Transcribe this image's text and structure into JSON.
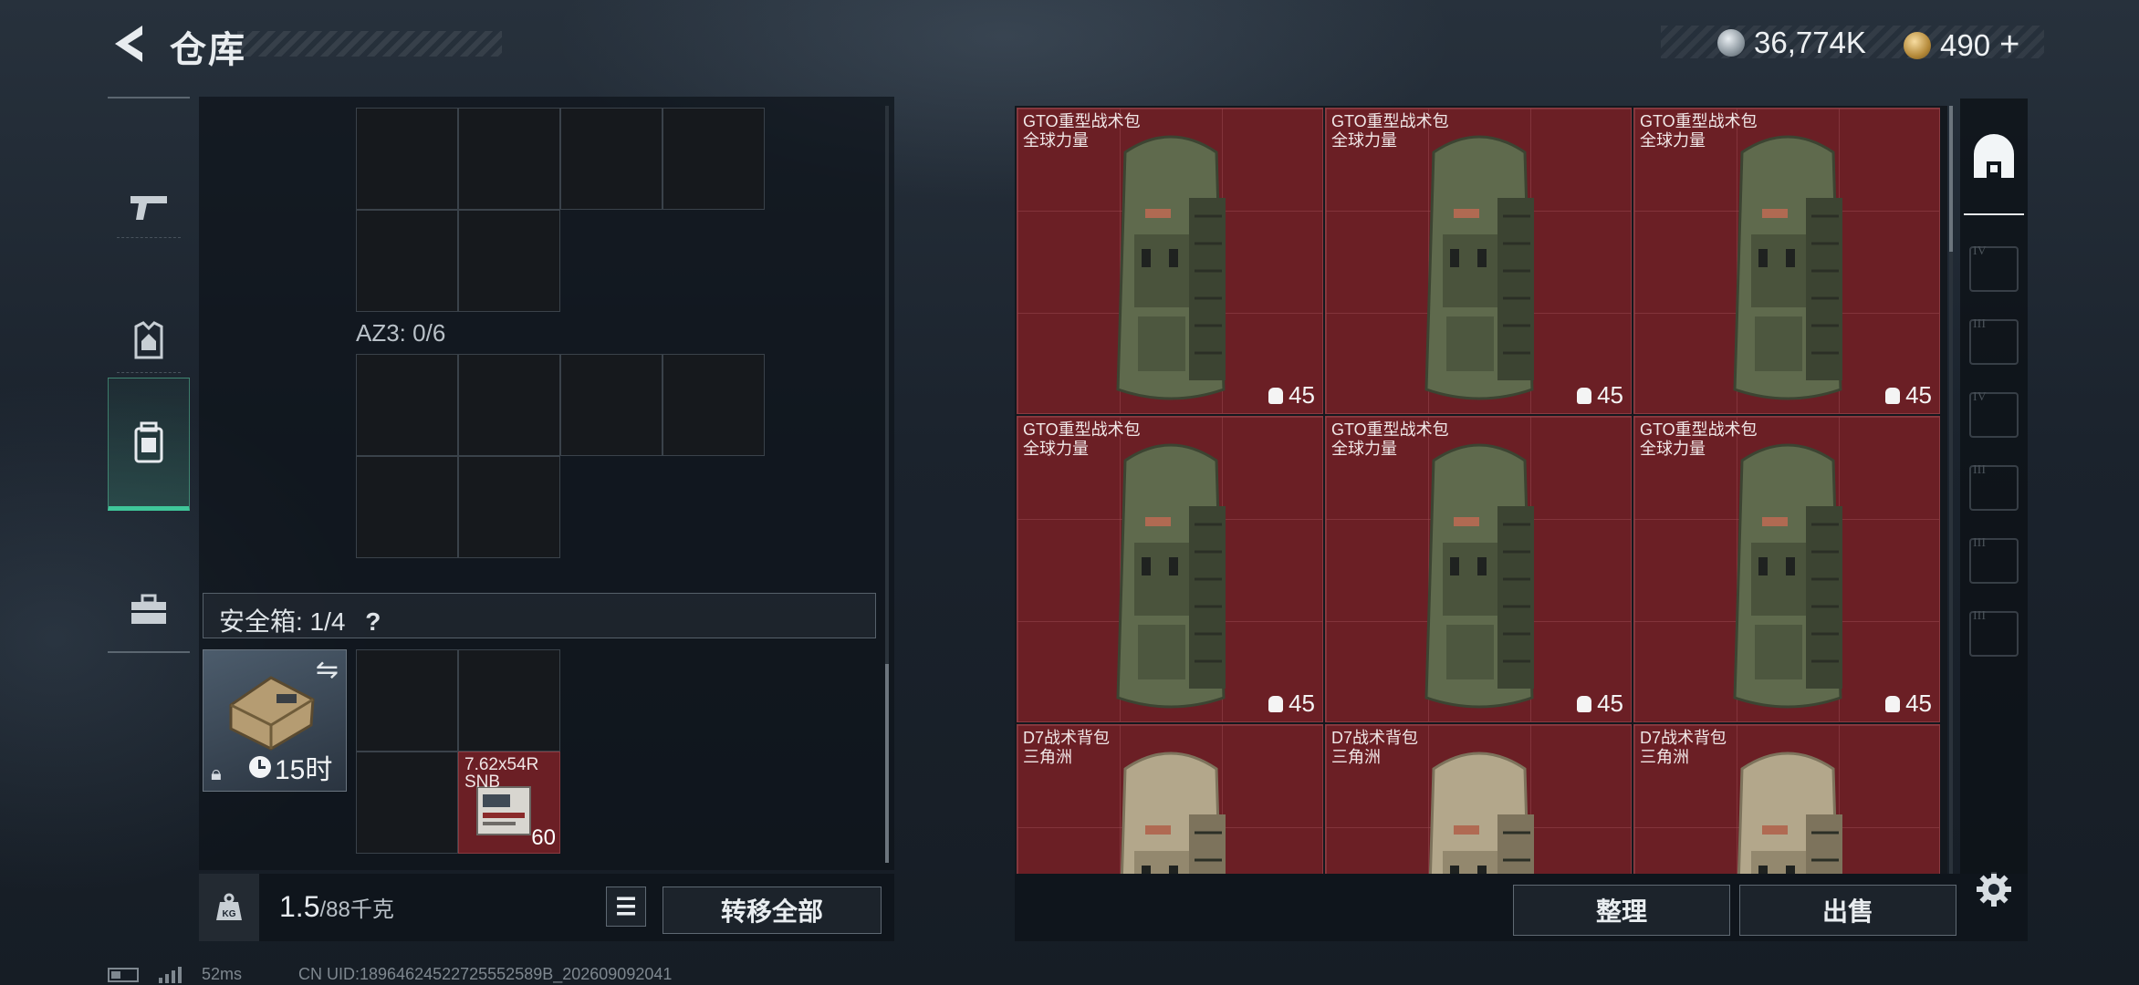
{
  "header": {
    "title": "仓库",
    "currency_primary": "36,774K",
    "currency_secondary": "490",
    "add_symbol": "+"
  },
  "left_nav": {
    "items": [
      {
        "icon": "pistol-icon"
      },
      {
        "icon": "chest-rig-icon"
      },
      {
        "icon": "backpack-icon",
        "active": true
      },
      {
        "icon": "toolbox-icon"
      }
    ]
  },
  "storage": {
    "az3_label": "AZ3: 0/6",
    "safe_box_label": "安全箱: 1/4",
    "help_symbol": "?",
    "safe_box_timer": "15时",
    "ammo_name_line1": "7.62x54R",
    "ammo_name_line2": "SNB",
    "ammo_count": "60"
  },
  "weight": {
    "current": "1.5",
    "max": "/88千克"
  },
  "buttons": {
    "transfer_all": "转移全部",
    "organize": "整理",
    "sell": "出售"
  },
  "items": [
    {
      "name": "GTO重型战术包",
      "brand": "全球力量",
      "count": "45",
      "color": "green"
    },
    {
      "name": "GTO重型战术包",
      "brand": "全球力量",
      "count": "45",
      "color": "green"
    },
    {
      "name": "GTO重型战术包",
      "brand": "全球力量",
      "count": "45",
      "color": "green"
    },
    {
      "name": "GTO重型战术包",
      "brand": "全球力量",
      "count": "45",
      "color": "green"
    },
    {
      "name": "GTO重型战术包",
      "brand": "全球力量",
      "count": "45",
      "color": "green"
    },
    {
      "name": "GTO重型战术包",
      "brand": "全球力量",
      "count": "45",
      "color": "green"
    },
    {
      "name": "D7战术背包",
      "brand": "三角洲",
      "count": "",
      "color": "tan"
    },
    {
      "name": "D7战术背包",
      "brand": "三角洲",
      "count": "",
      "color": "tan"
    },
    {
      "name": "D7战术背包",
      "brand": "三角洲",
      "count": "",
      "color": "tan"
    }
  ],
  "right_tabs": [
    "IV",
    "III",
    "IV",
    "III",
    "III",
    "III"
  ],
  "status_bar": {
    "ping": "52ms",
    "uid": "CN UID:18964624522725552589B_202609092041"
  },
  "colors": {
    "accent_green": "#3fc79a",
    "item_slot_red": "#6b1f25"
  }
}
